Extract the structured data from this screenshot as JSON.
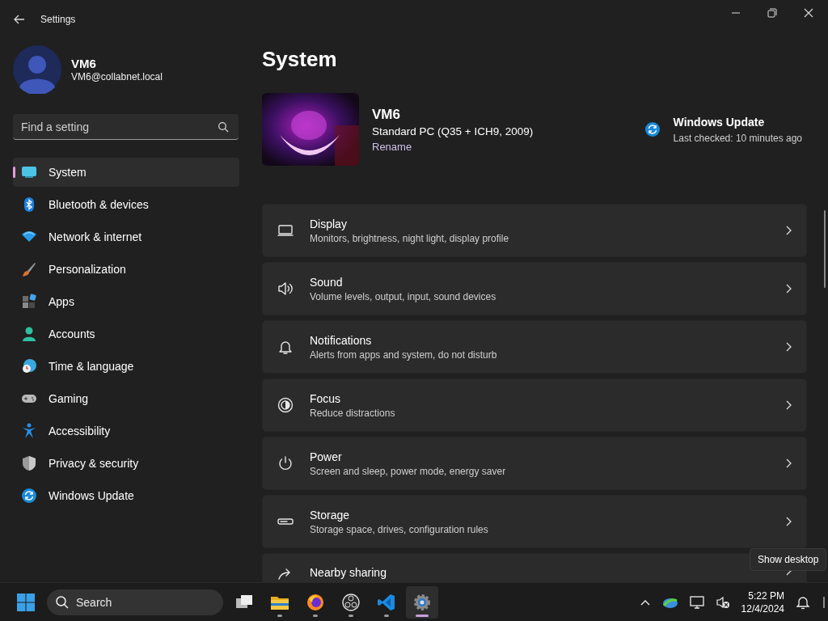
{
  "window": {
    "title": "Settings"
  },
  "profile": {
    "name": "VM6",
    "email": "VM6@collabnet.local"
  },
  "search": {
    "placeholder": "Find a setting"
  },
  "nav": [
    {
      "label": "System",
      "kind": "system",
      "selected": true
    },
    {
      "label": "Bluetooth & devices",
      "kind": "bluetooth",
      "selected": false
    },
    {
      "label": "Network & internet",
      "kind": "network",
      "selected": false
    },
    {
      "label": "Personalization",
      "kind": "brush",
      "selected": false
    },
    {
      "label": "Apps",
      "kind": "apps",
      "selected": false
    },
    {
      "label": "Accounts",
      "kind": "accounts",
      "selected": false
    },
    {
      "label": "Time & language",
      "kind": "time",
      "selected": false
    },
    {
      "label": "Gaming",
      "kind": "gaming",
      "selected": false
    },
    {
      "label": "Accessibility",
      "kind": "accessibility",
      "selected": false
    },
    {
      "label": "Privacy & security",
      "kind": "shield",
      "selected": false
    },
    {
      "label": "Windows Update",
      "kind": "update",
      "selected": false
    }
  ],
  "page_title": "System",
  "device": {
    "name": "VM6",
    "model": "Standard PC (Q35 + ICH9, 2009)",
    "rename": "Rename"
  },
  "update": {
    "title": "Windows Update",
    "status": "Last checked: 10 minutes ago"
  },
  "cards": [
    {
      "kind": "display",
      "title": "Display",
      "subtitle": "Monitors, brightness, night light, display profile"
    },
    {
      "kind": "sound",
      "title": "Sound",
      "subtitle": "Volume levels, output, input, sound devices"
    },
    {
      "kind": "bell",
      "title": "Notifications",
      "subtitle": "Alerts from apps and system, do not disturb"
    },
    {
      "kind": "focus",
      "title": "Focus",
      "subtitle": "Reduce distractions"
    },
    {
      "kind": "power",
      "title": "Power",
      "subtitle": "Screen and sleep, power mode, energy saver"
    },
    {
      "kind": "storage",
      "title": "Storage",
      "subtitle": "Storage space, drives, configuration rules"
    },
    {
      "kind": "share",
      "title": "Nearby sharing"
    }
  ],
  "tooltip": "Show desktop",
  "taskbar": {
    "search": "Search",
    "apps": [
      {
        "kind": "taskview",
        "running": false,
        "selected": false
      },
      {
        "kind": "folder",
        "running": true,
        "selected": false
      },
      {
        "kind": "firefox",
        "running": true,
        "selected": false
      },
      {
        "kind": "obs",
        "running": true,
        "selected": false
      },
      {
        "kind": "vscode",
        "running": true,
        "selected": false
      },
      {
        "kind": "gear",
        "running": true,
        "selected": true
      }
    ],
    "time": "5:22 PM",
    "date": "12/4/2024"
  }
}
